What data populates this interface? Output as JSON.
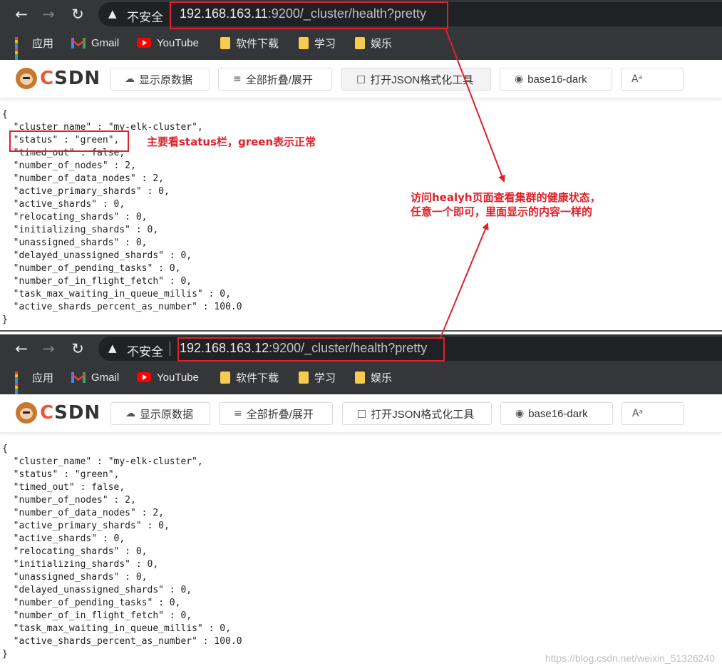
{
  "browser": {
    "insecure_label": "不安全",
    "windows": [
      {
        "url_host": "192.168.163.11",
        "url_rest": ":9200/_cluster/health?pretty"
      },
      {
        "url_host": "192.168.163.12",
        "url_rest": ":9200/_cluster/health?pretty"
      }
    ],
    "bookmarks": [
      {
        "label": "应用",
        "icon": "apps-icon"
      },
      {
        "label": "Gmail",
        "icon": "gmail-icon"
      },
      {
        "label": "YouTube",
        "icon": "youtube-icon"
      },
      {
        "label": "软件下载",
        "icon": "folder-icon"
      },
      {
        "label": "学习",
        "icon": "folder-icon"
      },
      {
        "label": "娱乐",
        "icon": "folder-icon"
      }
    ]
  },
  "viewer": {
    "logo": "CSDN",
    "buttons": [
      {
        "label": "显示原数据",
        "icon": "cloud-icon"
      },
      {
        "label": "全部折叠/展开",
        "icon": "collapse-icon"
      },
      {
        "label": "打开JSON格式化工具",
        "icon": "json-icon"
      },
      {
        "label": "base16-dark",
        "icon": "palette-icon"
      },
      {
        "label": "",
        "icon": "font-size-icon"
      }
    ]
  },
  "json_lines": [
    "{",
    "  \"cluster_name\" : \"my-elk-cluster\",",
    "  \"status\" : \"green\",",
    "  \"timed_out\" : false,",
    "  \"number_of_nodes\" : 2,",
    "  \"number_of_data_nodes\" : 2,",
    "  \"active_primary_shards\" : 0,",
    "  \"active_shards\" : 0,",
    "  \"relocating_shards\" : 0,",
    "  \"initializing_shards\" : 0,",
    "  \"unassigned_shards\" : 0,",
    "  \"delayed_unassigned_shards\" : 0,",
    "  \"number_of_pending_tasks\" : 0,",
    "  \"number_of_in_flight_fetch\" : 0,",
    "  \"task_max_waiting_in_queue_millis\" : 0,",
    "  \"active_shards_percent_as_number\" : 100.0",
    "}"
  ],
  "annotations": {
    "status_note": "主要看status栏，green表示正常",
    "health_note_line1": "访问healyh页面查看集群的健康状态，",
    "health_note_line2": "任意一个即可，里面显示的内容一样的",
    "color": "#e0202a"
  },
  "watermark": "https://blog.csdn.net/weixin_51326240"
}
